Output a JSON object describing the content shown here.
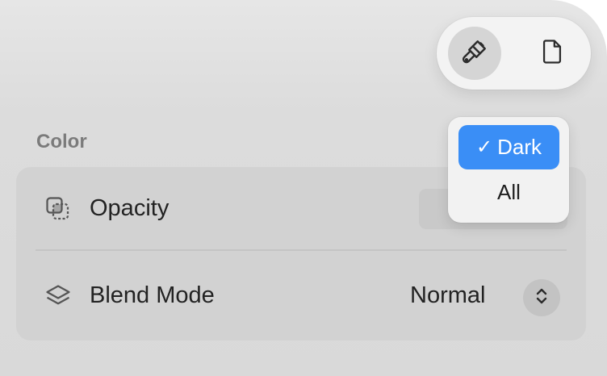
{
  "toolbar": {
    "buttons": [
      {
        "name": "paintbrush",
        "icon": "paintbrush-icon",
        "selected": true
      },
      {
        "name": "document",
        "icon": "document-icon",
        "selected": false
      }
    ]
  },
  "section": {
    "title": "Color"
  },
  "rows": {
    "opacity": {
      "label": "Opacity",
      "icon": "opacity-icon"
    },
    "blend_mode": {
      "label": "Blend Mode",
      "icon": "layers-icon",
      "value": "Normal"
    }
  },
  "dropdown": {
    "options": [
      {
        "label": "Dark",
        "selected": true,
        "check": "✓"
      },
      {
        "label": "All",
        "selected": false
      }
    ]
  },
  "colors": {
    "accent": "#3a8ef6",
    "panel": "#d9d9d9",
    "card": "#d2d2d2"
  }
}
